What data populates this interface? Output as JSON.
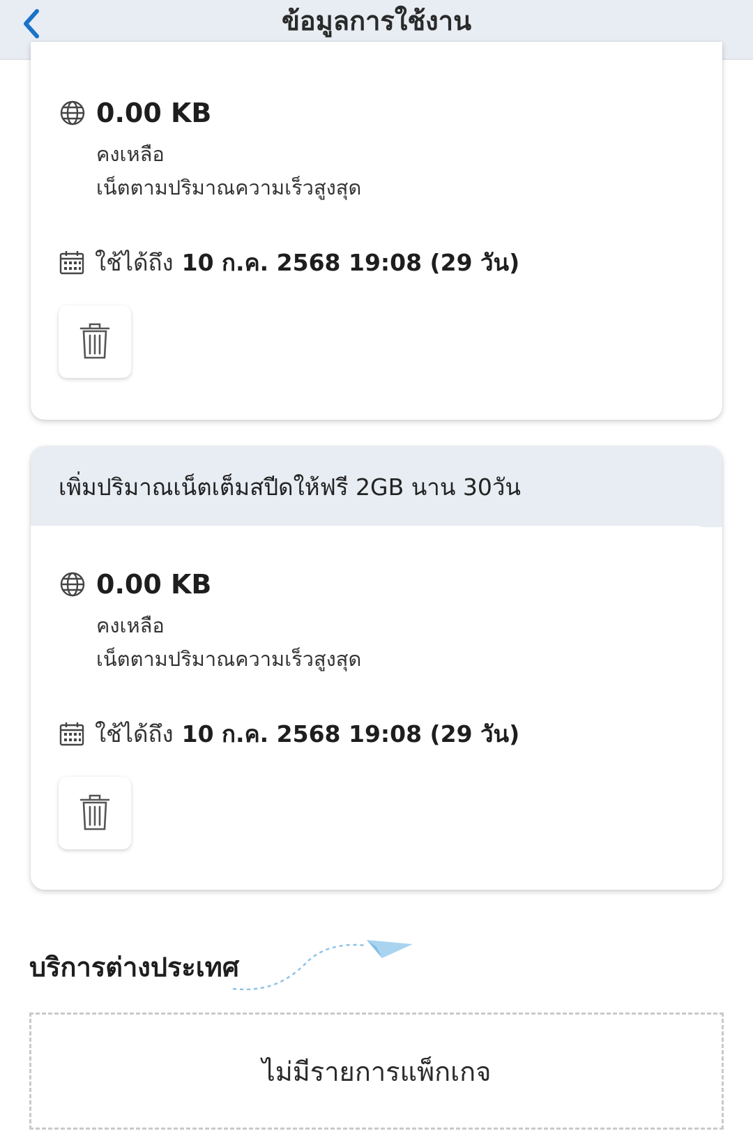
{
  "header": {
    "title": "ข้อมูลการใช้งาน"
  },
  "packages": [
    {
      "title": "",
      "amount": "0.00 KB",
      "remaining_label": "คงเหลือ",
      "type_label": "เน็ตตามปริมาณความเร็วสูงสุด",
      "expire_label": "ใช้ได้ถึง",
      "expire_value": "10 ก.ค. 2568 19:08 (29 วัน)"
    },
    {
      "title": "เพิ่มปริมาณเน็ตเต็มสปีดให้ฟรี 2GB นาน 30วัน",
      "amount": "0.00 KB",
      "remaining_label": "คงเหลือ",
      "type_label": "เน็ตตามปริมาณความเร็วสูงสุด",
      "expire_label": "ใช้ได้ถึง",
      "expire_value": "10 ก.ค. 2568 19:08 (29 วัน)"
    }
  ],
  "international": {
    "title": "บริการต่างประเทศ",
    "empty_text": "ไม่มีรายการแพ็กเกจ"
  },
  "colors": {
    "accent": "#1a73c8",
    "header_bg": "#e8edf3"
  },
  "icons": [
    "chevron-left-icon",
    "globe-icon",
    "calendar-icon",
    "trash-icon",
    "paper-plane-icon"
  ]
}
